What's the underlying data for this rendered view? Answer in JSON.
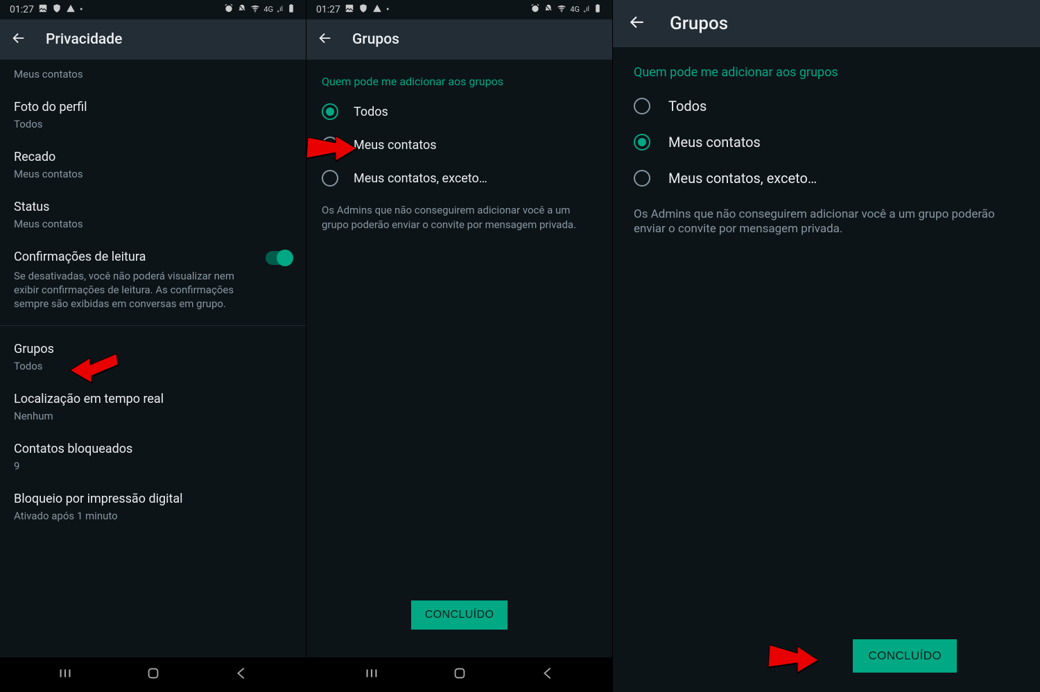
{
  "status": {
    "time": "01:27",
    "net_label": "4G",
    "signal": "₊ıl"
  },
  "screen1": {
    "title": "Privacidade",
    "items": {
      "lastseen_sub": "Meus contatos",
      "photo_title": "Foto do perfil",
      "photo_sub": "Todos",
      "about_title": "Recado",
      "about_sub": "Meus contatos",
      "status_title": "Status",
      "status_sub": "Meus contatos",
      "read_title": "Confirmações de leitura",
      "read_desc": "Se desativadas, você não poderá visualizar nem exibir confirmações de leitura. As confirmações sempre são exibidas em conversas em grupo.",
      "groups_title": "Grupos",
      "groups_sub": "Todos",
      "live_title": "Localização em tempo real",
      "live_sub": "Nenhum",
      "blocked_title": "Contatos bloqueados",
      "blocked_sub": "9",
      "finger_title": "Bloqueio por impressão digital",
      "finger_sub": "Ativado após 1 minuto"
    }
  },
  "screen2": {
    "title": "Grupos",
    "header": "Quem pode me adicionar aos grupos",
    "opt_everyone": "Todos",
    "opt_contacts": "Meus contatos",
    "opt_except": "Meus contatos, exceto…",
    "helper": "Os Admins que não conseguirem adicionar você a um grupo poderão enviar o convite por mensagem privada.",
    "done": "CONCLUÍDO"
  },
  "screen3": {
    "title": "Grupos",
    "header": "Quem pode me adicionar aos grupos",
    "opt_everyone": "Todos",
    "opt_contacts": "Meus contatos",
    "opt_except": "Meus contatos, exceto…",
    "helper": "Os Admins que não conseguirem adicionar você a um grupo poderão enviar o convite por mensagem privada.",
    "done": "CONCLUÍDO"
  }
}
